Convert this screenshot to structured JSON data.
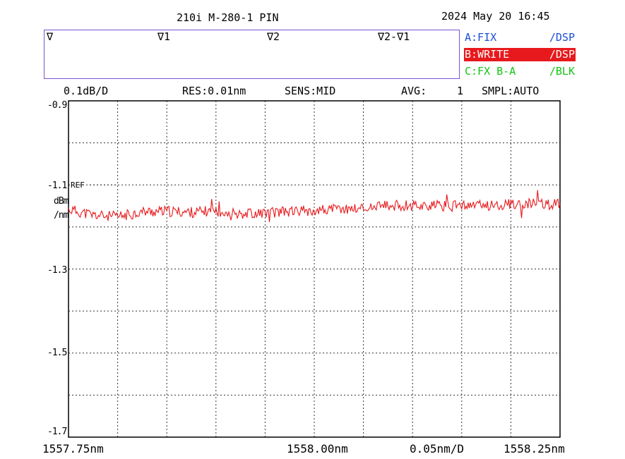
{
  "title": "210i M-280-1 PIN",
  "datetime": "2024 May 20 16:45",
  "markers": [
    "∇",
    "∇1",
    "∇2",
    "∇2-∇1"
  ],
  "traces": [
    {
      "label": "A:FIX",
      "mode": "/DSP",
      "color": "#1a4fd6",
      "highlight": false
    },
    {
      "label": "B:WRITE",
      "mode": "/DSP",
      "color": "#ffffff",
      "bg": "#e8191c",
      "highlight": true
    },
    {
      "label": "C:FX B-A",
      "mode": "/BLK",
      "color": "#13c413",
      "highlight": false
    }
  ],
  "status": {
    "scale": "0.1dB/D",
    "res": "RES:0.01nm",
    "sens": "SENS:MID",
    "avg_label": "AVG:",
    "avg_value": "1",
    "smpl": "SMPL:AUTO"
  },
  "y_unit": {
    "line1": "dBm",
    "line2": "/nm"
  },
  "ref_label": "REF",
  "x_labels": {
    "start": "1557.75nm",
    "center": "1558.00nm",
    "span": "0.05nm/D",
    "stop": "1558.25nm"
  },
  "chart_data": {
    "type": "line",
    "xlabel": "",
    "ylabel": "dBm/nm",
    "xlim": [
      1557.75,
      1558.25
    ],
    "ylim": [
      -1.7,
      -0.9
    ],
    "y_ticks": [
      "-0.9",
      "-1.1",
      "-1.3",
      "-1.5",
      "-1.7"
    ],
    "grid": true,
    "x_divisions": 10,
    "y_divisions": 8,
    "series": [
      {
        "color": "#e8191c",
        "x": [
          1557.75,
          1557.775,
          1557.8,
          1557.825,
          1557.85,
          1557.875,
          1557.9,
          1557.925,
          1557.95,
          1557.975,
          1558.0,
          1558.025,
          1558.05,
          1558.075,
          1558.1,
          1558.125,
          1558.15,
          1558.175,
          1558.2,
          1558.225,
          1558.25
        ],
        "y": [
          -1.158,
          -1.172,
          -1.176,
          -1.164,
          -1.163,
          -1.165,
          -1.162,
          -1.168,
          -1.166,
          -1.164,
          -1.16,
          -1.158,
          -1.155,
          -1.15,
          -1.148,
          -1.15,
          -1.15,
          -1.148,
          -1.146,
          -1.146,
          -1.146
        ]
      }
    ]
  }
}
